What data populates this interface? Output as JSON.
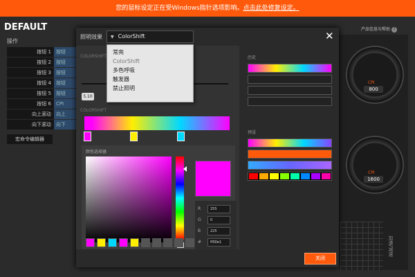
{
  "warning": {
    "text": "您的鼠标设定正在受Windows指针选项影响。",
    "link": "点击此处修复设定。"
  },
  "app": {
    "title": "DEFAULT",
    "help_text": "产品信息与帮助",
    "help_icon": "?"
  },
  "buttons_section": {
    "heading": "操作",
    "rows": [
      {
        "label": "按钮 1",
        "value": "按钮"
      },
      {
        "label": "按钮 2",
        "value": "按钮"
      },
      {
        "label": "按钮 3",
        "value": "按钮"
      },
      {
        "label": "按钮 4",
        "value": "按钮"
      },
      {
        "label": "按钮 5",
        "value": "按钮"
      },
      {
        "label": "按钮 6",
        "value": "CPI"
      },
      {
        "label": "向上滚动",
        "value": "向上"
      },
      {
        "label": "向下滚动",
        "value": "向下"
      }
    ],
    "macro_editor": "宏命令编辑器"
  },
  "gauges": [
    {
      "label": "CPI",
      "value": "800"
    },
    {
      "label": "CPI",
      "value": "1600"
    }
  ],
  "side_label": "加速/减速",
  "modal": {
    "effect_label": "照明效果",
    "effect_selected": "ColorShift",
    "colorshift_label": "COLORSHIFT",
    "speed_value": "5.10",
    "colorshift_label2": "COLORSHIFT",
    "picker_label": "颜色选择器",
    "fields": [
      {
        "key": "R",
        "value": "255"
      },
      {
        "key": "G",
        "value": "0"
      },
      {
        "key": "B",
        "value": "225"
      },
      {
        "key": "#",
        "value": "ff00e1"
      }
    ],
    "history_label": "历史",
    "presets_label": "预设",
    "close_button": "关闭",
    "hue_button": "▼",
    "colors": {
      "preview": "#ff00ff",
      "swatches": [
        "#ff00ff",
        "#ffee00",
        "#00d8ff",
        "#ff00ff",
        "#ffee00",
        "#555555",
        "#555555",
        "#555555",
        "#555555",
        "#555555"
      ],
      "stops": [
        "#ff00ff",
        "#ffee00",
        "#00d8ff"
      ],
      "preset_dots": [
        "#ff0000",
        "#ffaa00",
        "#ffff00",
        "#88ff00",
        "#00ffaa",
        "#0088ff",
        "#aa00ff",
        "#ff00aa"
      ]
    }
  },
  "dropdown": {
    "items": [
      {
        "label": "常亮",
        "selected": false
      },
      {
        "label": "ColorShift",
        "selected": true
      },
      {
        "label": "多色呼吸",
        "selected": false
      },
      {
        "label": "触发器",
        "selected": false
      },
      {
        "label": "禁止照明",
        "selected": false
      }
    ]
  }
}
